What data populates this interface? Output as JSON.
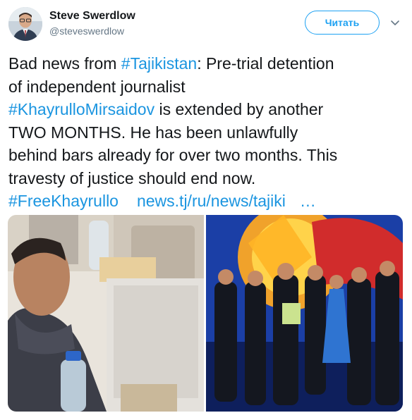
{
  "author": {
    "name": "Steve Swerdlow",
    "handle": "@steveswerdlow",
    "avatar_icon": "user-avatar"
  },
  "follow_label": "Читать",
  "menu_icon": "chevron-down-icon",
  "tweet": {
    "line1": {
      "prefix": "Bad news from ",
      "hashtag": "#Tajikistan",
      "suffix": ": Pre-trial detention"
    },
    "line2": "of independent journalist",
    "line3": {
      "hashtag": "#KhayrulloMirsaidov",
      "suffix": " is extended by another"
    },
    "line4": "TWO MONTHS. He has been unlawfully",
    "line5": "behind bars already for over two months. This",
    "line6": "travesty of justice should end now.",
    "line7": {
      "hashtag": "#FreeKhayrullo",
      "url": "news.tj/ru/news/tajiki",
      "ellipsis": "…"
    }
  },
  "media": {
    "photo1": "man-portrait-photo",
    "photo2": "group-stage-photo"
  },
  "colors": {
    "link": "#1b95e0",
    "accent": "#1da1f2",
    "text": "#14171a",
    "secondary": "#657786"
  }
}
